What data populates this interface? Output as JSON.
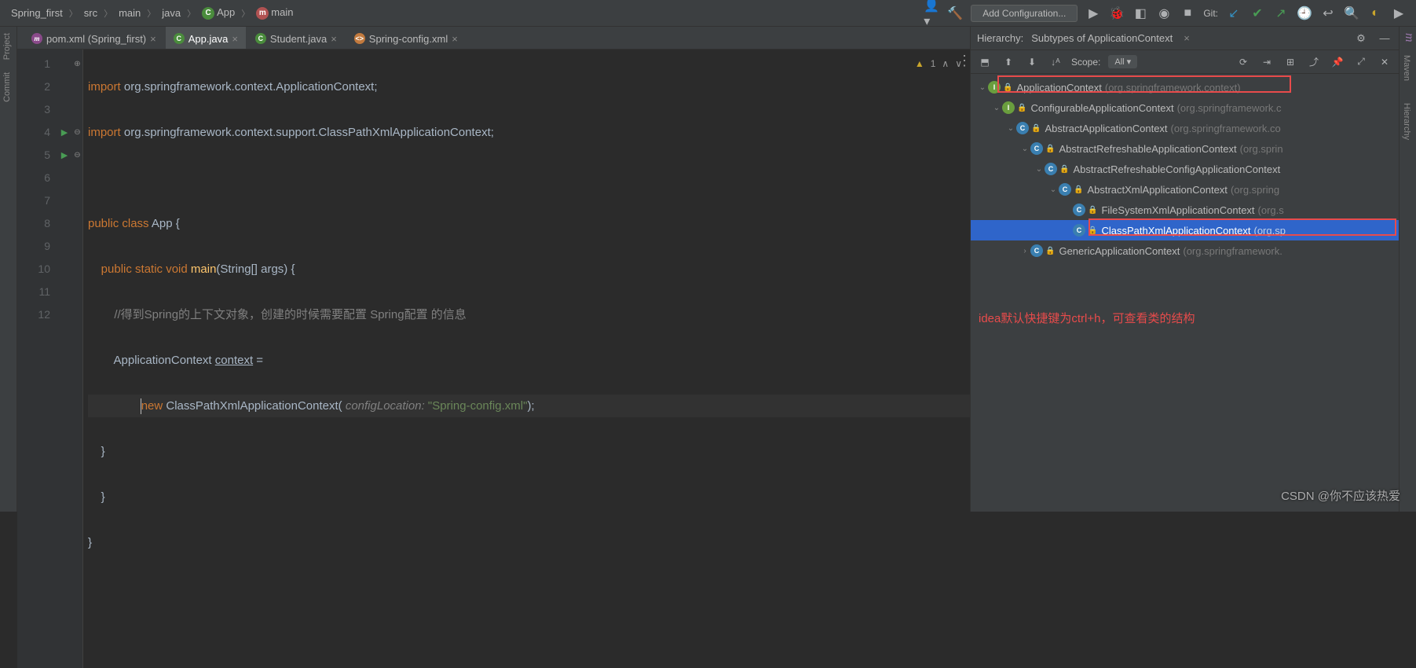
{
  "breadcrumbs": [
    "Spring_first",
    "src",
    "main",
    "java",
    "App",
    "main"
  ],
  "toolbar": {
    "add_config": "Add Configuration...",
    "git_label": "Git:"
  },
  "left_tabs": [
    "Project",
    "Commit"
  ],
  "right_tabs": [
    "Maven",
    "Hierarchy"
  ],
  "tabs": [
    {
      "label": "pom.xml (Spring_first)",
      "icon": "m",
      "active": false
    },
    {
      "label": "App.java",
      "icon": "c",
      "active": true
    },
    {
      "label": "Student.java",
      "icon": "c",
      "active": false
    },
    {
      "label": "Spring-config.xml",
      "icon": "x",
      "active": false
    }
  ],
  "editor": {
    "lines": 12,
    "warn_count": "1",
    "code": {
      "l1a": "import",
      "l1b": " org.springframework.context.ApplicationContext;",
      "l2a": "import",
      "l2b": " org.springframework.context.support.ClassPathXmlApplicationContext;",
      "l4a": "public class ",
      "l4b": "App {",
      "l5a": "public static void ",
      "l5b": "main",
      "l5c": "(String[] args) {",
      "l6": "//得到Spring的上下文对象，创建的时候需要配置 Spring配置 的信息",
      "l7a": "ApplicationContext ",
      "l7b": "context",
      "l7c": " =",
      "l8a": "new ",
      "l8b": "ClassPathXmlApplicationContext(",
      "l8c": "configLocation:",
      "l8d": " \"Spring-config.xml\"",
      "l8e": ");",
      "l9": "}",
      "l10": "}",
      "l11": "}"
    }
  },
  "hierarchy": {
    "title": "Hierarchy:",
    "subtitle": "Subtypes of ApplicationContext",
    "scope_label": "Scope:",
    "scope_value": "All",
    "nodes": [
      {
        "indent": 0,
        "arrow": "v",
        "icon": "I",
        "iconBg": "#6a9e3e",
        "name": "ApplicationContext",
        "pkg": "(org.springframework.context)"
      },
      {
        "indent": 1,
        "arrow": "v",
        "icon": "I",
        "iconBg": "#6a9e3e",
        "name": "ConfigurableApplicationContext",
        "pkg": "(org.springframework.c"
      },
      {
        "indent": 2,
        "arrow": "v",
        "icon": "C",
        "iconBg": "#3a7fb0",
        "name": "AbstractApplicationContext",
        "pkg": "(org.springframework.co"
      },
      {
        "indent": 3,
        "arrow": "v",
        "icon": "C",
        "iconBg": "#3a7fb0",
        "name": "AbstractRefreshableApplicationContext",
        "pkg": "(org.sprin"
      },
      {
        "indent": 4,
        "arrow": "v",
        "icon": "C",
        "iconBg": "#3a7fb0",
        "name": "AbstractRefreshableConfigApplicationContext",
        "pkg": ""
      },
      {
        "indent": 5,
        "arrow": "v",
        "icon": "C",
        "iconBg": "#3a7fb0",
        "name": "AbstractXmlApplicationContext",
        "pkg": "(org.spring"
      },
      {
        "indent": 6,
        "arrow": "",
        "icon": "C",
        "iconBg": "#3a7fb0",
        "name": "FileSystemXmlApplicationContext",
        "pkg": "(org.s"
      },
      {
        "indent": 6,
        "arrow": "",
        "icon": "C",
        "iconBg": "#3a7fb0",
        "name": "ClassPathXmlApplicationContext",
        "pkg": "(org.sp",
        "selected": true
      },
      {
        "indent": 3,
        "arrow": ">",
        "icon": "C",
        "iconBg": "#3a7fb0",
        "name": "GenericApplicationContext",
        "pkg": "(org.springframework."
      }
    ],
    "annotation": "idea默认快捷键为ctrl+h，可查看类的结构"
  },
  "watermark": "CSDN @你不应该热爱"
}
